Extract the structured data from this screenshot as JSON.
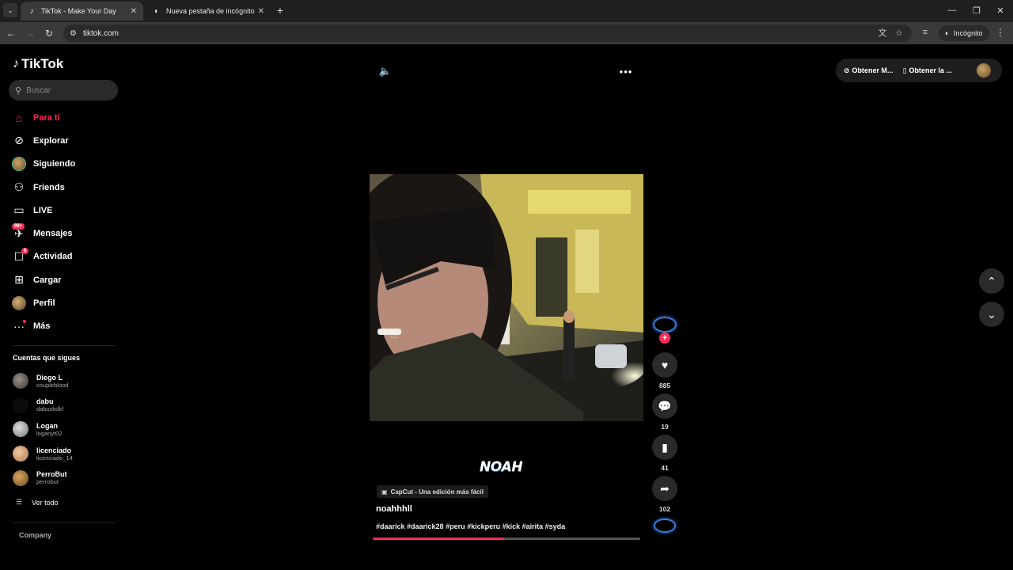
{
  "browser": {
    "tabs": [
      {
        "title": "TikTok - Make Your Day",
        "active": true,
        "icon": "tiktok-icon"
      },
      {
        "title": "Nueva pestaña de incógnito",
        "active": false,
        "icon": "incognito-icon"
      }
    ],
    "url": "tiktok.com",
    "incognito_label": "Incógnito"
  },
  "sidebar": {
    "logo_text": "TikTok",
    "search_placeholder": "Buscar",
    "nav": [
      {
        "label": "Para ti",
        "icon": "home-icon",
        "active": true
      },
      {
        "label": "Explorar",
        "icon": "compass-icon"
      },
      {
        "label": "Siguiendo",
        "icon": "avatar"
      },
      {
        "label": "Friends",
        "icon": "friends-icon"
      },
      {
        "label": "LIVE",
        "icon": "live-icon"
      },
      {
        "label": "Mensajes",
        "icon": "messages-icon",
        "badge": "99+"
      },
      {
        "label": "Actividad",
        "icon": "activity-icon",
        "badge": "8"
      },
      {
        "label": "Cargar",
        "icon": "upload-icon"
      },
      {
        "label": "Perfil",
        "icon": "avatar"
      },
      {
        "label": "Más",
        "icon": "more-icon",
        "dot": true
      }
    ],
    "following_title": "Cuentas que sigues",
    "following": [
      {
        "name": "Diego L",
        "username": "coupleblood"
      },
      {
        "name": "dabu",
        "username": "dabuskdkf"
      },
      {
        "name": "Logan",
        "username": "loganyt02"
      },
      {
        "name": "licenciado",
        "username": "licenciado_14"
      },
      {
        "name": "PerroBut",
        "username": "perrobut"
      }
    ],
    "see_all": "Ver todo",
    "company": "Company"
  },
  "header": {
    "get_coins": "Obtener M...",
    "get_app": "Obtener la ..."
  },
  "video": {
    "overlay_logo": "NOAH",
    "capcut_label": "CapCut - Una edición más fácil",
    "author": "noahhhll",
    "description": "#daarick #daarick28 #peru #kickperu #kick #airita #syda",
    "progress": 0.49,
    "likes": "885",
    "comments": "19",
    "saves": "41",
    "shares": "102"
  },
  "colors": {
    "accent": "#fe2c55",
    "background": "#000000"
  }
}
